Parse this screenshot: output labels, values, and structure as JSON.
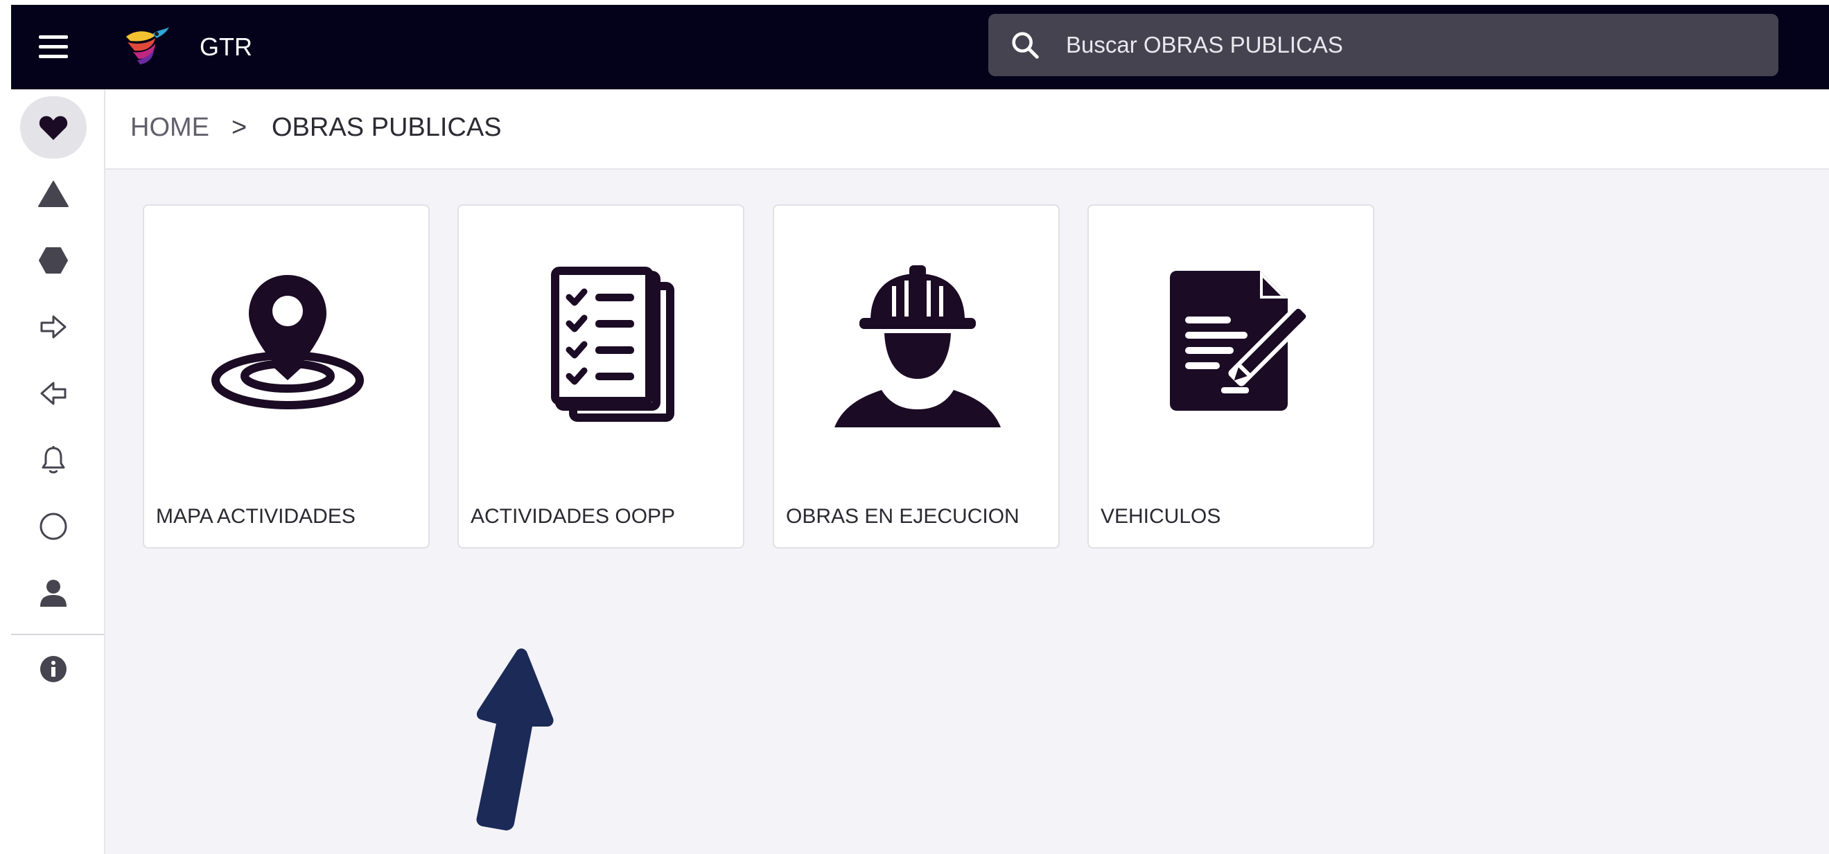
{
  "header": {
    "app_title": "GTR",
    "menu_icon": "hamburger-menu-icon",
    "logo_icon": "hummingbird-logo-icon",
    "bg_color": "#03021a"
  },
  "search": {
    "icon": "search-icon",
    "placeholder": "Buscar OBRAS PUBLICAS"
  },
  "sidebar": {
    "items": [
      {
        "icon": "heart-icon",
        "active": true
      },
      {
        "icon": "triangle-icon",
        "active": false
      },
      {
        "icon": "hexagon-icon",
        "active": false
      },
      {
        "icon": "arrow-right-icon",
        "active": false
      },
      {
        "icon": "arrow-left-icon",
        "active": false
      },
      {
        "icon": "bell-icon",
        "active": false
      },
      {
        "icon": "circle-icon",
        "active": false
      },
      {
        "icon": "user-icon",
        "active": false
      },
      {
        "icon": "info-icon",
        "active": false
      }
    ]
  },
  "breadcrumb": {
    "home": "HOME",
    "separator": ">",
    "current": "OBRAS PUBLICAS"
  },
  "tiles": [
    {
      "label": "MAPA ACTIVIDADES",
      "icon": "map-pin-icon"
    },
    {
      "label": "ACTIVIDADES OOPP",
      "icon": "checklist-icon"
    },
    {
      "label": "OBRAS EN EJECUCION",
      "icon": "construction-worker-icon"
    },
    {
      "label": "VEHICULOS",
      "icon": "document-edit-icon"
    }
  ],
  "annotation": {
    "icon": "pointer-arrow-icon",
    "color": "#1b2a57"
  },
  "colors": {
    "icon_dark": "#1c0b24",
    "page_bg": "#f4f3f8"
  }
}
